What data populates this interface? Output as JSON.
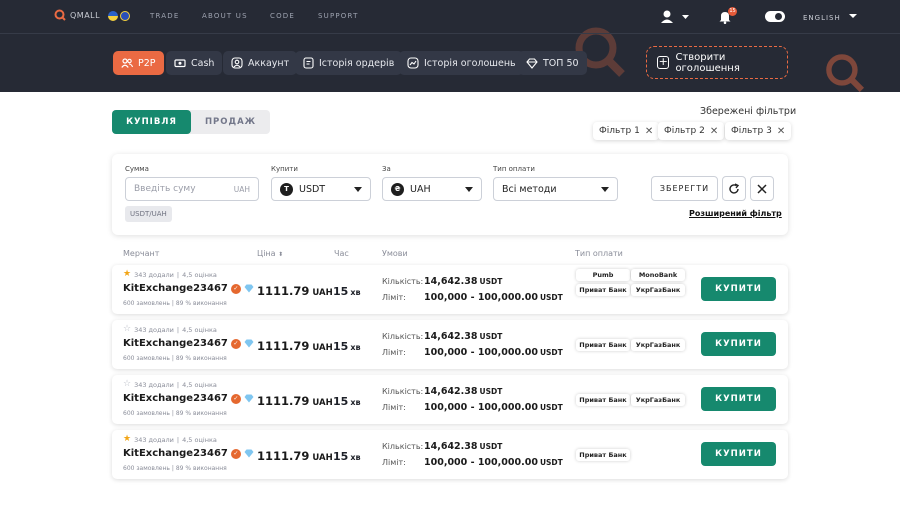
{
  "header": {
    "logo_text": "QMALL",
    "nav": [
      "TRADE",
      "ABOUT US",
      "CODE",
      "SUPPORT"
    ],
    "notifications_count": "15",
    "language": "ENGLISH"
  },
  "tabs": [
    {
      "label": "P2P",
      "icon": "users-icon",
      "active": true
    },
    {
      "label": "Cash",
      "icon": "cash-icon"
    },
    {
      "label": "Аккаунт",
      "icon": "account-icon"
    },
    {
      "label": "Історія ордерів",
      "icon": "order-history-icon"
    },
    {
      "label": "Історія оголошень",
      "icon": "ads-history-icon"
    },
    {
      "label": "ТОП 50",
      "icon": "diamond-icon"
    }
  ],
  "create_ad_label": "Створити оголошення",
  "mode": {
    "buy": "КУПІВЛЯ",
    "sell": "ПРОДАЖ",
    "active": "buy"
  },
  "saved_filters": {
    "label": "Збережені фільтри",
    "items": [
      "Фільтр 1",
      "Фільтр 2",
      "Фільтр 3"
    ]
  },
  "filters": {
    "amount": {
      "label": "Сумма",
      "placeholder": "Введіть суму",
      "unit": "UAH"
    },
    "buy": {
      "label": "Купити",
      "value": "USDT"
    },
    "for": {
      "label": "За",
      "value": "UAH"
    },
    "payment": {
      "label": "Тип оплати",
      "value": "Всі методи"
    },
    "pair": "USDT/UAH",
    "save_label": "ЗБЕРЕГТИ",
    "advanced_label": "Розширений фільтр"
  },
  "columns": {
    "merchant": "Мерчант",
    "price": "Ціна",
    "time": "Час",
    "terms": "Умови",
    "payment": "Тип оплати"
  },
  "offers": [
    {
      "star_filled": true,
      "likes": "343 додали",
      "rating": "4,5 оцінка",
      "name": "KitExchange23467",
      "orders": "600 замовлень",
      "completion": "89 % виконання",
      "price": "1111.79",
      "currency": "UAH",
      "time": "15",
      "time_unit": "хв",
      "qty_label": "Кількість:",
      "qty": "14,642.38",
      "qty_unit": "USDT",
      "limit_label": "Ліміт:",
      "limit": "100,000 - 100,000.00",
      "limit_unit": "USDT",
      "payments": [
        "Pumb",
        "MonoBank",
        "Приват Банк",
        "УкрГазБанк"
      ],
      "buy_label": "КУПИТИ"
    },
    {
      "star_filled": false,
      "likes": "343 додали",
      "rating": "4,5 оцінка",
      "name": "KitExchange23467",
      "orders": "600 замовлень",
      "completion": "89 % виконання",
      "price": "1111.79",
      "currency": "UAH",
      "time": "15",
      "time_unit": "хв",
      "qty_label": "Кількість:",
      "qty": "14,642.38",
      "qty_unit": "USDT",
      "limit_label": "Ліміт:",
      "limit": "100,000 - 100,000.00",
      "limit_unit": "USDT",
      "payments": [
        "Приват Банк",
        "УкрГазБанк"
      ],
      "buy_label": "КУПИТИ"
    },
    {
      "star_filled": false,
      "likes": "343 додали",
      "rating": "4,5 оцінка",
      "name": "KitExchange23467",
      "orders": "600 замовлень",
      "completion": "89 % виконання",
      "price": "1111.79",
      "currency": "UAH",
      "time": "15",
      "time_unit": "хв",
      "qty_label": "Кількість:",
      "qty": "14,642.38",
      "qty_unit": "USDT",
      "limit_label": "Ліміт:",
      "limit": "100,000 - 100,000.00",
      "limit_unit": "USDT",
      "payments": [
        "Приват Банк",
        "УкрГазБанк"
      ],
      "buy_label": "КУПИТИ"
    },
    {
      "star_filled": true,
      "likes": "343 додали",
      "rating": "4,5 оцінка",
      "name": "KitExchange23467",
      "orders": "600 замовлень",
      "completion": "89 % виконання",
      "price": "1111.79",
      "currency": "UAH",
      "time": "15",
      "time_unit": "хв",
      "qty_label": "Кількість:",
      "qty": "14,642.38",
      "qty_unit": "USDT",
      "limit_label": "Ліміт:",
      "limit": "100,000 - 100,000.00",
      "limit_unit": "USDT",
      "payments": [
        "Приват Банк"
      ],
      "buy_label": "КУПИТИ"
    }
  ],
  "colors": {
    "accent": "#ea6a43",
    "primary": "#16896e",
    "header_bg": "#262a35"
  }
}
